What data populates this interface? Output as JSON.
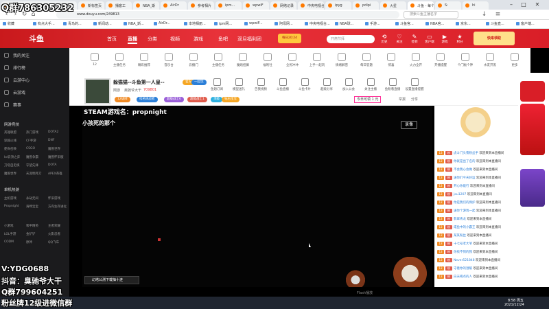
{
  "browser": {
    "tabs": [
      "斗鱼 | 每个人的直播平台",
      "新标签页",
      "播客工",
      "NBA_斯",
      "AirDr",
      "参考相片",
      "ipm...",
      "wpwiF",
      "网络记录",
      "中央电视台",
      "ipyg",
      "pdipi",
      "火星",
      "斗鱼 - 每个人",
      "S:",
      "hi"
    ],
    "url": "www.douyu.com/249813",
    "search_placeholder": "搜索斗鱼主播名字",
    "bookmarks": [
      "收藏",
      "有点大手...",
      "青鸟的...",
      "新闻动...",
      "NBA_斯...",
      "AirDr...",
      "本地相册...",
      "ipm网...",
      "wpwiF...",
      "阿母网...",
      "中央电视台...",
      "NBA球...",
      "手游...",
      "斗鱼官...",
      "NBA官...",
      "京东...",
      "斗鱼直...",
      "客户端..."
    ]
  },
  "douyu": {
    "logo": "斗鱼",
    "nav": [
      "首页",
      "直播",
      "分类",
      "视频",
      "游戏",
      "鱼吧",
      "双旦福利团"
    ],
    "active_nav": "直播",
    "promo_badge": "每日20:24",
    "search_placeholder": "开斋节拜",
    "header_icons": [
      "历史",
      "关注",
      "签到",
      "客户端",
      "游戏",
      "积分"
    ],
    "ad_right": "快来领取"
  },
  "sidebar": {
    "top_items": [
      "我的关注",
      "排行榜",
      "云游中心",
      "云游戏",
      "赛事"
    ],
    "section_game": "网游竞技",
    "games": [
      "英雄联盟",
      "热门游戏",
      "DOTA2",
      "穿越火线",
      "CF手游",
      "DNF",
      "使命召唤",
      "CSGO",
      "魔兽世界",
      "lol云顶之弈",
      "魔兽争霸",
      "魔兽怀旧服",
      "刀塔自走棋",
      "守望先锋",
      "DOTA",
      "魔兽世界",
      "天涯明月刀",
      "APEX英雄"
    ],
    "section_mobile": "单机热游",
    "mobile": [
      "主机游戏",
      "永劫无间",
      "怀旧游戏",
      "Propnight",
      "海绵宝宝",
      "方舟生存进化",
      "小游戏",
      "和平精英",
      "王者荣耀",
      "LOL手游",
      "金铲铲",
      "火影忍者",
      "CODM",
      "原神",
      "QQ飞车"
    ]
  },
  "categories": [
    "12",
    "主播任务",
    "精彩推荐",
    "音乐台",
    "云播门",
    "主播任务",
    "魔炮招募",
    "福利社",
    "全民冲冲",
    "上手一起玩",
    "情绪解密",
    "每日答题",
    "惊喜",
    "火力全开",
    "开播提醒",
    "个门板个神",
    "水友开黑",
    "更多"
  ],
  "room": {
    "title": "躲猫猫--斗鱼第一人皇--",
    "tag_official": "官方",
    "tag_rank": "一起玩",
    "streamer": "奥驰爷大干",
    "followers": "709801",
    "category": "网游",
    "tags": [
      "12级牌",
      "指名挑战者",
      "超级战士6",
      "超能战士1",
      "顶级",
      "钻石宝宝"
    ],
    "hot_value": "今日可领 1 元",
    "report": "举报",
    "share": "分享",
    "actions": [
      "鱼翅订阅",
      "模型送礼",
      "告我视频",
      "斗鱼直播",
      "斗鱼卡片",
      "超级分享",
      "加入公会",
      "关注主播",
      "鱼粉看直播",
      "设置直播提醒"
    ]
  },
  "video": {
    "overlay_game": "STEAM游戏名：propnight",
    "overlay_line2": "小孩死的那个",
    "record_btn": "录像",
    "bottom_text": "幻塔公测下载抽十连",
    "flash_label": "Flash播放"
  },
  "chat": {
    "messages": [
      {
        "user": "虎斗门头夜粉丝手",
        "text": "欢迎来到本直播间"
      },
      {
        "user": "你就是出了名的",
        "text": "欢迎来到本直播间"
      },
      {
        "user": "不会我心会做",
        "text": "欢迎来到本直播间"
      },
      {
        "user": "送你们今天好运",
        "text": "欢迎来到本直播间"
      },
      {
        "user": "开心你能行",
        "text": "欢迎来到本直播间"
      },
      {
        "user": "jou1207",
        "text": "欢迎来到本直播间"
      },
      {
        "user": "你是我们的保护",
        "text": "欢迎来到本直播间"
      },
      {
        "user": "送你个游戏一起",
        "text": "欢迎来到本直播间"
      },
      {
        "user": "翡翠青龙",
        "text": "欢迎来到本直播间"
      },
      {
        "user": "咸鱼中的小霸王",
        "text": "欢迎来到本直播间"
      },
      {
        "user": "某某粉丝",
        "text": "欢迎来到本直播间"
      },
      {
        "user": "十七号老大爷",
        "text": "欢迎来到本直播间"
      },
      {
        "user": "你找不到的我",
        "text": "欢迎来到本直播间"
      },
      {
        "user": "Never521848",
        "text": "欢迎来到本直播间"
      },
      {
        "user": "守着你的温暖",
        "text": "欢迎来到本直播间"
      },
      {
        "user": "白天喝点的人",
        "text": "欢迎来到本直播间"
      }
    ]
  },
  "overlays": {
    "qq_top": "Q群786305232",
    "v": "V:YDG0688",
    "douyin": "抖音：臭驰爷大干",
    "qq_bottom": "Q群799604251",
    "fans": "粉丝牌12级进微信群"
  },
  "taskbar": {
    "time": "8:58 周五",
    "date": "2021/12/24"
  },
  "colors": {
    "douyu_red": "#d91e27",
    "accent_orange": "#ff7a00"
  }
}
